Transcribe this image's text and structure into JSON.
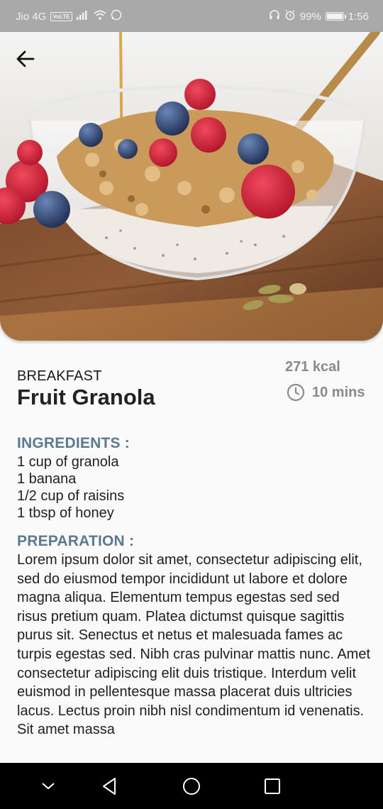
{
  "status_bar": {
    "carrier": "Jio 4G",
    "volte": "VoLTE",
    "battery_percent": "99%",
    "battery_level": 0.99,
    "time": "1:56"
  },
  "hero": {
    "image_description_icon": "fruit-granola-photo"
  },
  "recipe": {
    "category": "BREAKFAST",
    "title": "Fruit Granola",
    "calories": "271 kcal",
    "duration": "10 mins"
  },
  "ingredients": {
    "heading": "INGREDIENTS :",
    "items": [
      "1 cup of granola",
      "1 banana",
      "1/2 cup of raisins",
      "1 tbsp of honey"
    ]
  },
  "preparation": {
    "heading": "PREPARATION :",
    "text": "Lorem ipsum dolor sit amet, consectetur adipiscing elit, sed do eiusmod tempor incididunt ut labore et dolore magna aliqua. Elementum tempus egestas sed sed risus pretium quam. Platea dictumst quisque sagittis purus sit. Senectus et netus et malesuada fames ac turpis egestas sed. Nibh cras pulvinar mattis nunc. Amet consectetur adipiscing elit duis tristique. Interdum velit euismod in pellentesque massa placerat duis ultricies lacus. Lectus proin nibh nisl condimentum id venenatis. Sit amet massa"
  },
  "colors": {
    "heading_accent": "#5b7a8e",
    "muted_text": "#8a8a8a",
    "status_bar_bg": "#a9a9a9",
    "nav_bar_bg": "#000000"
  }
}
